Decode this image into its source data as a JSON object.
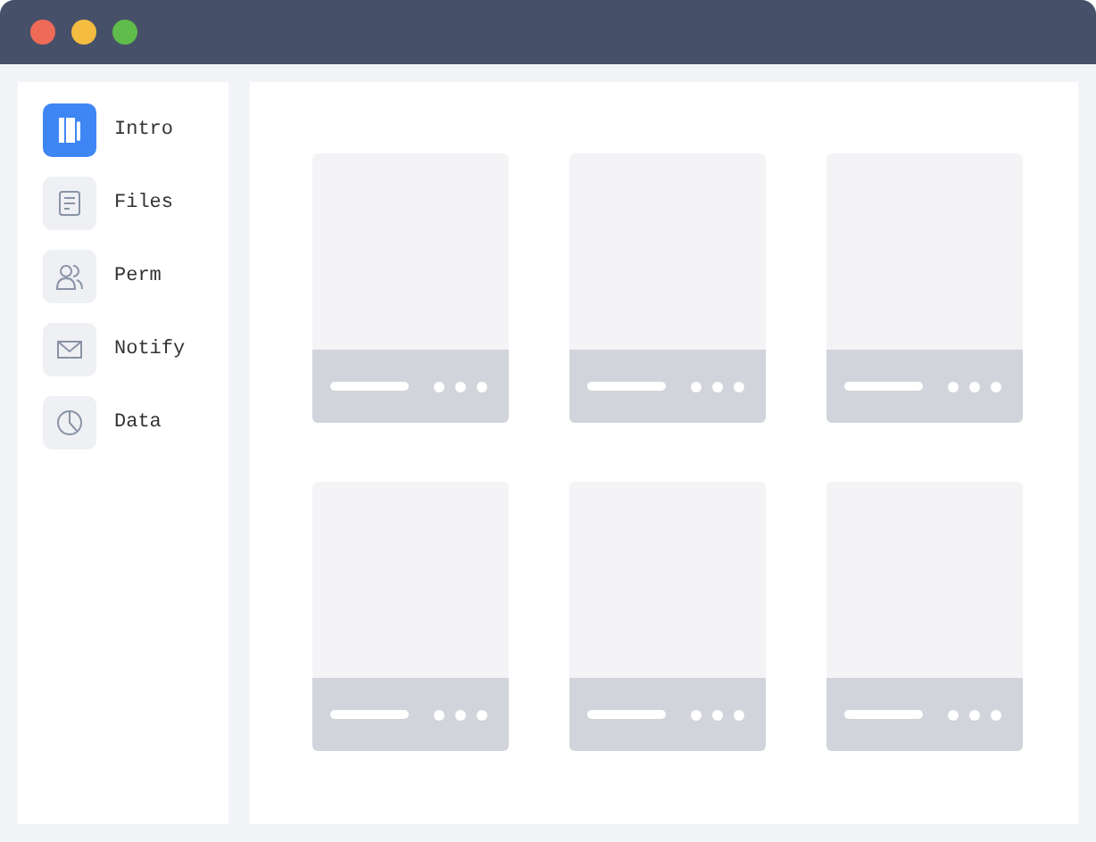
{
  "sidebar": {
    "items": [
      {
        "label": "Intro",
        "selected": true
      },
      {
        "label": "Files",
        "selected": false
      },
      {
        "label": "Perm",
        "selected": false
      },
      {
        "label": "Notify",
        "selected": false
      },
      {
        "label": "Data",
        "selected": false
      }
    ]
  },
  "cards": [
    {
      "kind": "placeholder"
    },
    {
      "kind": "placeholder"
    },
    {
      "kind": "placeholder"
    },
    {
      "kind": "placeholder"
    },
    {
      "kind": "placeholder"
    },
    {
      "kind": "placeholder"
    }
  ]
}
